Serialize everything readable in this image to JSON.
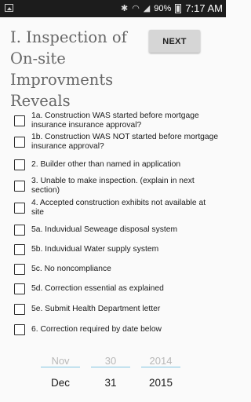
{
  "status_bar": {
    "battery": "90%",
    "time": "7:17 AM"
  },
  "page": {
    "title": "I. Inspection of On-site Improvments Reveals",
    "next_label": "NEXT"
  },
  "items": [
    {
      "label": "1a. Construction WAS started before mortgage insurance insurance approval?",
      "checked": false
    },
    {
      "label": "1b. Construction  WAS NOT started before mortgage insurance approval?",
      "checked": false
    },
    {
      "label": "2. Builder other than named in application",
      "checked": false
    },
    {
      "label": "3. Unable to make inspection. (explain in next section)",
      "checked": false
    },
    {
      "label": "4. Accepted construction exhibits not available at site",
      "checked": false
    },
    {
      "label": "5a. Induvidual Seweage disposal system",
      "checked": false
    },
    {
      "label": "5b. Induvidual Water supply system",
      "checked": false
    },
    {
      "label": "5c. No noncompliance",
      "checked": false
    },
    {
      "label": "5d. Correction essential as explained",
      "checked": false
    },
    {
      "label": "5e. Submit Health Department letter",
      "checked": false
    },
    {
      "label": "6. Correction required by date below",
      "checked": false
    }
  ],
  "date_picker": {
    "month_prev": "Nov",
    "day_prev": "30",
    "year_prev": "2014",
    "month": "Dec",
    "day": "31",
    "year": "2015"
  }
}
